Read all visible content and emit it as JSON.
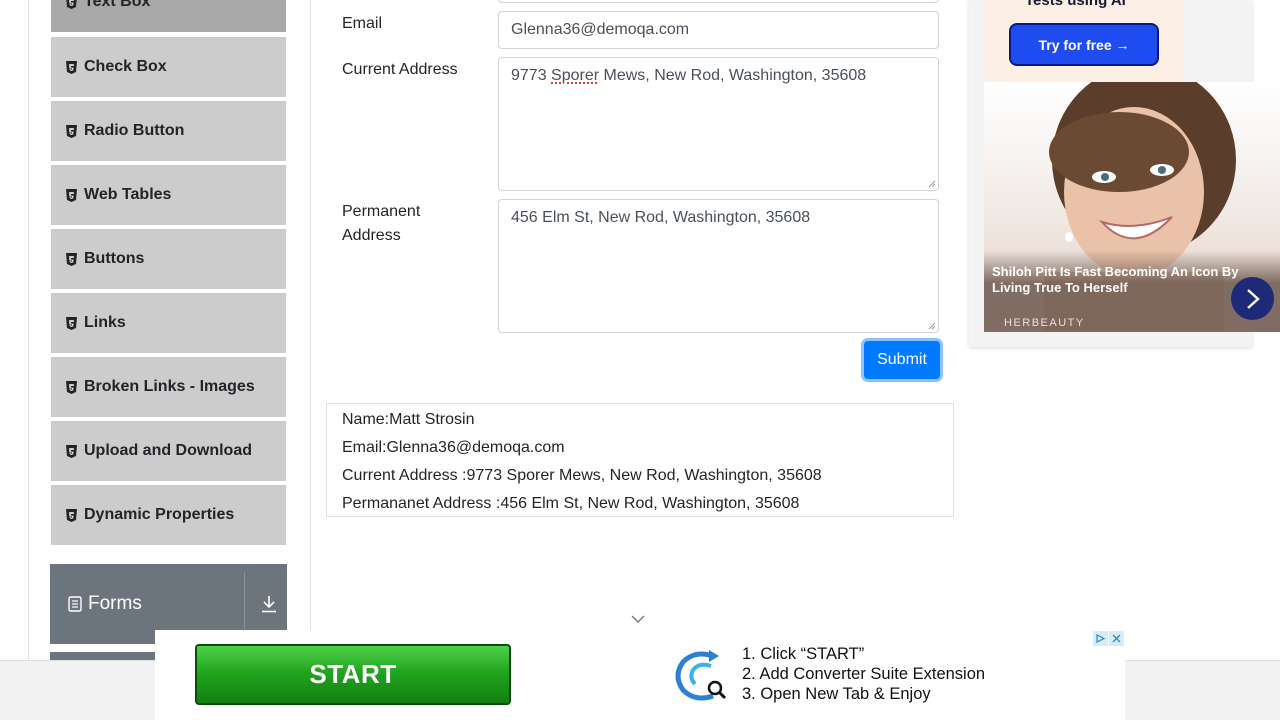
{
  "sidebar": {
    "items": [
      {
        "label": "Text Box",
        "active": true
      },
      {
        "label": "Check Box"
      },
      {
        "label": "Radio Button"
      },
      {
        "label": "Web Tables"
      },
      {
        "label": "Buttons"
      },
      {
        "label": "Links"
      },
      {
        "label": "Broken Links - Images"
      },
      {
        "label": "Upload and Download"
      },
      {
        "label": "Dynamic Properties"
      }
    ],
    "group": {
      "title": "Forms",
      "icon": "list-icon",
      "toggle_icon": "download-arrow-icon"
    }
  },
  "form": {
    "email_label": "Email",
    "email_value": "Glenna36@demoqa.com",
    "current_address_label": "Current Address",
    "current_address_prefix": "9773 ",
    "current_address_misspelled": "Sporer",
    "current_address_suffix": " Mews, New Rod, Washington, 35608",
    "permanent_address_label_1": "Permanent",
    "permanent_address_label_2": "Address",
    "permanent_address_value": "456 Elm St, New Rod, Washington, 35608",
    "submit_label": "Submit"
  },
  "output": {
    "name": "Name:Matt Strosin",
    "email": "Email:Glenna36@demoqa.com",
    "current_address": "Current Address :9773 Sporer Mews, New Rod, Washington, 35608",
    "permanent_address": "Permananet Address :456 Elm St, New Rod, Washington, 35608"
  },
  "side_ad": {
    "top_text": "Tests using AI",
    "button_label": "Try for free →",
    "caption": "Shiloh Pitt Is Fast Becoming An Icon By Living True To Herself",
    "brand": "HERBEAUTY"
  },
  "bottom_ad": {
    "start_label": "START",
    "steps": [
      "1. Click “START”",
      "2. Add Converter Suite Extension",
      "3. Open New Tab & Enjoy"
    ]
  },
  "colors": {
    "primary": "#007bff",
    "sidebar_item": "#cccccc",
    "sidebar_active": "#a8a8a8",
    "group_header": "#6c757d",
    "ad_button": "#1f4cf0",
    "start_green": "#22a51f"
  }
}
